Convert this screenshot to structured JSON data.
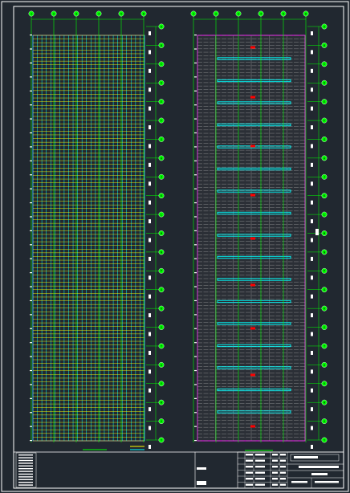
{
  "viewer": {
    "background": "#212830",
    "border_color": "#ffffff",
    "plan_left": {
      "name": "roof-framing-plan",
      "grid_color": "#00ff00",
      "purlin_color": "#ffff00",
      "rafter_color": "#00ffff",
      "column_axes": [
        "1",
        "2",
        "3",
        "4",
        "5",
        "6"
      ],
      "row_axes": [
        "A",
        "B",
        "C",
        "D",
        "E",
        "F",
        "G",
        "H",
        "J",
        "K",
        "L",
        "M",
        "N",
        "P",
        "Q",
        "R",
        "S",
        "T",
        "U",
        "V",
        "W",
        "X",
        "Y"
      ]
    },
    "plan_right": {
      "name": "floor-slab-plan",
      "grid_color": "#00ff00",
      "slab_hatch_color": "#b0b0b0",
      "beam_color": "#00ffff",
      "marker_color": "#ff0000",
      "boundary_color": "#ff00ff",
      "column_axes": [
        "1",
        "2",
        "3",
        "4",
        "5",
        "6"
      ],
      "row_axes": [
        "A",
        "B",
        "C",
        "D",
        "E",
        "F",
        "G",
        "H",
        "J",
        "K",
        "L",
        "M",
        "N",
        "P",
        "Q",
        "R",
        "S",
        "T",
        "U",
        "V",
        "W",
        "X",
        "Y"
      ]
    },
    "title_block": {
      "name": "drawing-title-block"
    }
  }
}
